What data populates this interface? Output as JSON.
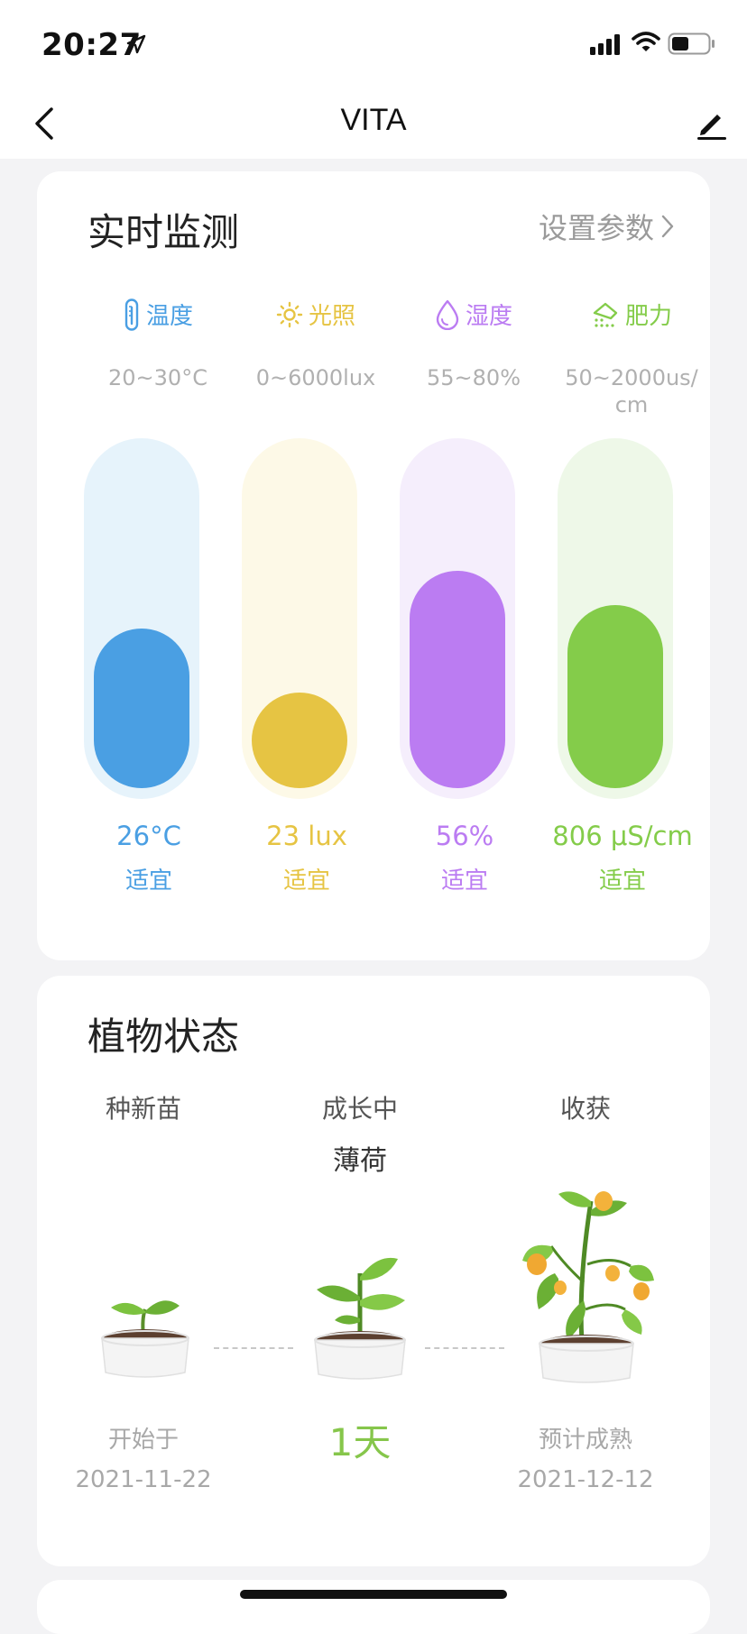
{
  "status": {
    "time": "20:27"
  },
  "nav": {
    "title": "VITA"
  },
  "monitor": {
    "title": "实时监测",
    "settings_label": "设置参数",
    "metrics": [
      {
        "label": "温度",
        "icon": "thermometer-icon",
        "range": "20~30°C",
        "value": "26°C",
        "status": "适宜",
        "level": 0.47,
        "color": "#4a9fe3",
        "track": "#e6f3fb"
      },
      {
        "label": "光照",
        "icon": "sun-icon",
        "range": "0~6000lux",
        "value": "23 lux",
        "status": "适宜",
        "level": 0.26,
        "color": "#e6c443",
        "track": "#fdf9e7"
      },
      {
        "label": "湿度",
        "icon": "water-drop-icon",
        "range": "55~80%",
        "value": "56%",
        "status": "适宜",
        "level": 0.64,
        "color": "#bb7cf2",
        "track": "#f5eefc"
      },
      {
        "label": "肥力",
        "icon": "fertilizer-icon",
        "range": "50~2000us/\ncm",
        "value": "806 μS/cm",
        "status": "适宜",
        "level": 0.54,
        "color": "#84cc4a",
        "track": "#eef8e8"
      }
    ]
  },
  "plant": {
    "title": "植物状态",
    "plant_name": "薄荷",
    "stages": [
      {
        "label": "种新苗",
        "sub": "开始于",
        "date": "2021-11-22"
      },
      {
        "label": "成长中",
        "days": "1天"
      },
      {
        "label": "收获",
        "sub": "预计成熟",
        "date": "2021-12-12"
      }
    ]
  }
}
